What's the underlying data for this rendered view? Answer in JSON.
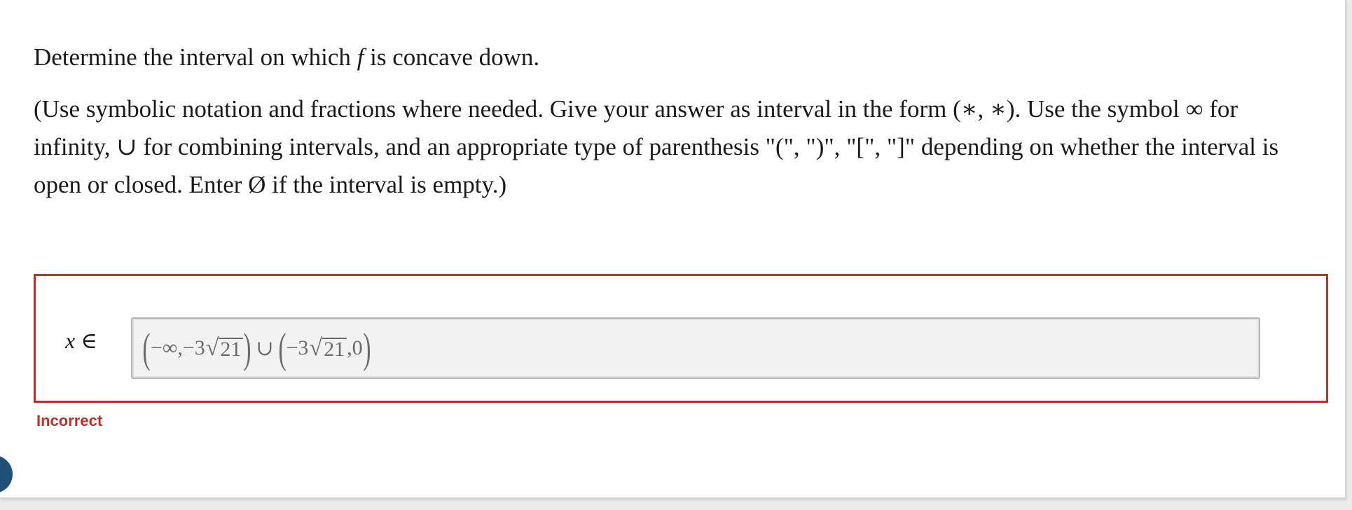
{
  "question": {
    "prompt_before": "Determine the interval on which ",
    "prompt_var": "f",
    "prompt_after": " is concave down.",
    "instructions_lines": [
      "(Use symbolic notation and fractions where needed. Give your answer as interval in the form (∗, ∗). Use the symbol ∞ for",
      "infinity, ∪ for combining intervals, and an appropriate type of parenthesis \"(\", \")\", \"[\", \"]\" depending on whether the interval is",
      "open or closed. Enter Ø if the interval is empty.)"
    ]
  },
  "answer": {
    "variable": "x",
    "relation": "∈",
    "entered": {
      "part1_open": "(",
      "part1_text": "−∞,−3",
      "part1_radicand": "21",
      "part1_close": ")",
      "union": "∪",
      "part2_open": "(",
      "part2_text": "−3",
      "part2_radicand": "21",
      "part2_tail": ",0",
      "part2_close": ")"
    },
    "status": "Incorrect",
    "status_color": "#c0302b"
  },
  "help_button_icon": "help-circle-icon"
}
